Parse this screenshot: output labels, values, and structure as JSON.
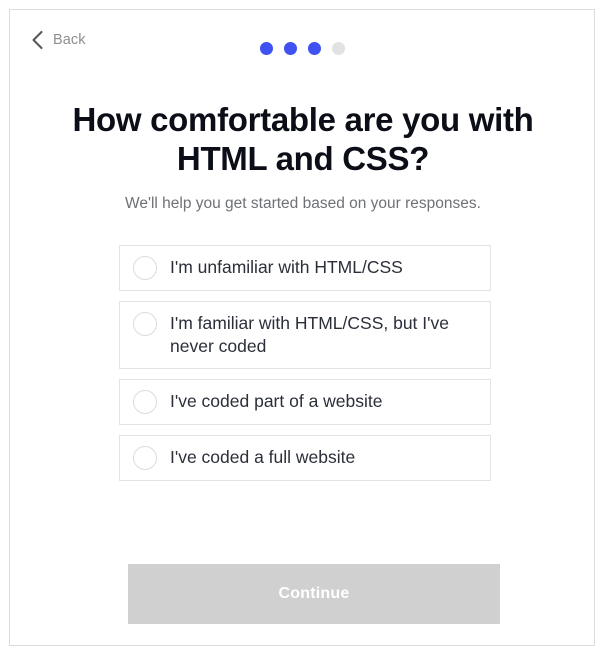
{
  "topbar": {
    "back_label": "Back",
    "back_icon": "chevron-left-icon",
    "progress": {
      "total_steps": 4,
      "completed_steps": 3,
      "active_color": "#3f51f0",
      "inactive_color": "#e2e2e4"
    }
  },
  "main": {
    "headline": "How comfortable are you with HTML and CSS?",
    "subhead": "We'll help you get started based on your responses.",
    "options": [
      {
        "label": "I'm unfamiliar with HTML/CSS",
        "selected": false
      },
      {
        "label": "I'm familiar with HTML/CSS, but I've never coded",
        "selected": false
      },
      {
        "label": "I've coded part of a website",
        "selected": false
      },
      {
        "label": "I've coded a full website",
        "selected": false
      }
    ]
  },
  "footer": {
    "continue_label": "Continue",
    "continue_enabled": false,
    "continue_bg": "#d0d0d0",
    "continue_text_color": "#ffffff"
  }
}
